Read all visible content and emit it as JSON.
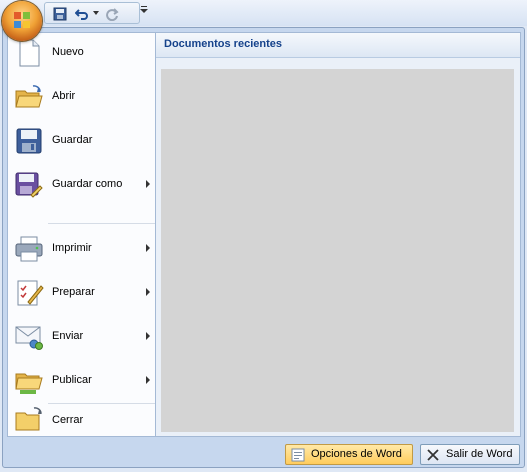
{
  "quick_access": {
    "office_button": "office-button",
    "items": [
      {
        "icon": "save-icon"
      },
      {
        "icon": "undo-icon"
      },
      {
        "icon": "redo-icon"
      },
      {
        "icon": "customize-arrow-icon"
      }
    ]
  },
  "menu": {
    "items": [
      {
        "label": "Nuevo",
        "icon": "new-document-icon",
        "submenu": false
      },
      {
        "label": "Abrir",
        "icon": "open-folder-icon",
        "submenu": false
      },
      {
        "label": "Guardar",
        "icon": "save-icon",
        "submenu": false
      },
      {
        "label": "Guardar como",
        "icon": "save-as-icon",
        "submenu": true
      },
      {
        "label": "Imprimir",
        "icon": "print-icon",
        "submenu": true
      },
      {
        "label": "Preparar",
        "icon": "prepare-icon",
        "submenu": true
      },
      {
        "label": "Enviar",
        "icon": "send-icon",
        "submenu": true
      },
      {
        "label": "Publicar",
        "icon": "publish-icon",
        "submenu": true
      },
      {
        "label": "Cerrar",
        "icon": "close-folder-icon",
        "submenu": false
      }
    ]
  },
  "recent": {
    "title": "Documentos recientes",
    "documents": []
  },
  "bottom": {
    "options_label": "Opciones de Word",
    "exit_label": "Salir de Word"
  },
  "colors": {
    "accent": "#15428b",
    "frame": "#c6d7ee",
    "highlight": "#ffcc5c"
  }
}
